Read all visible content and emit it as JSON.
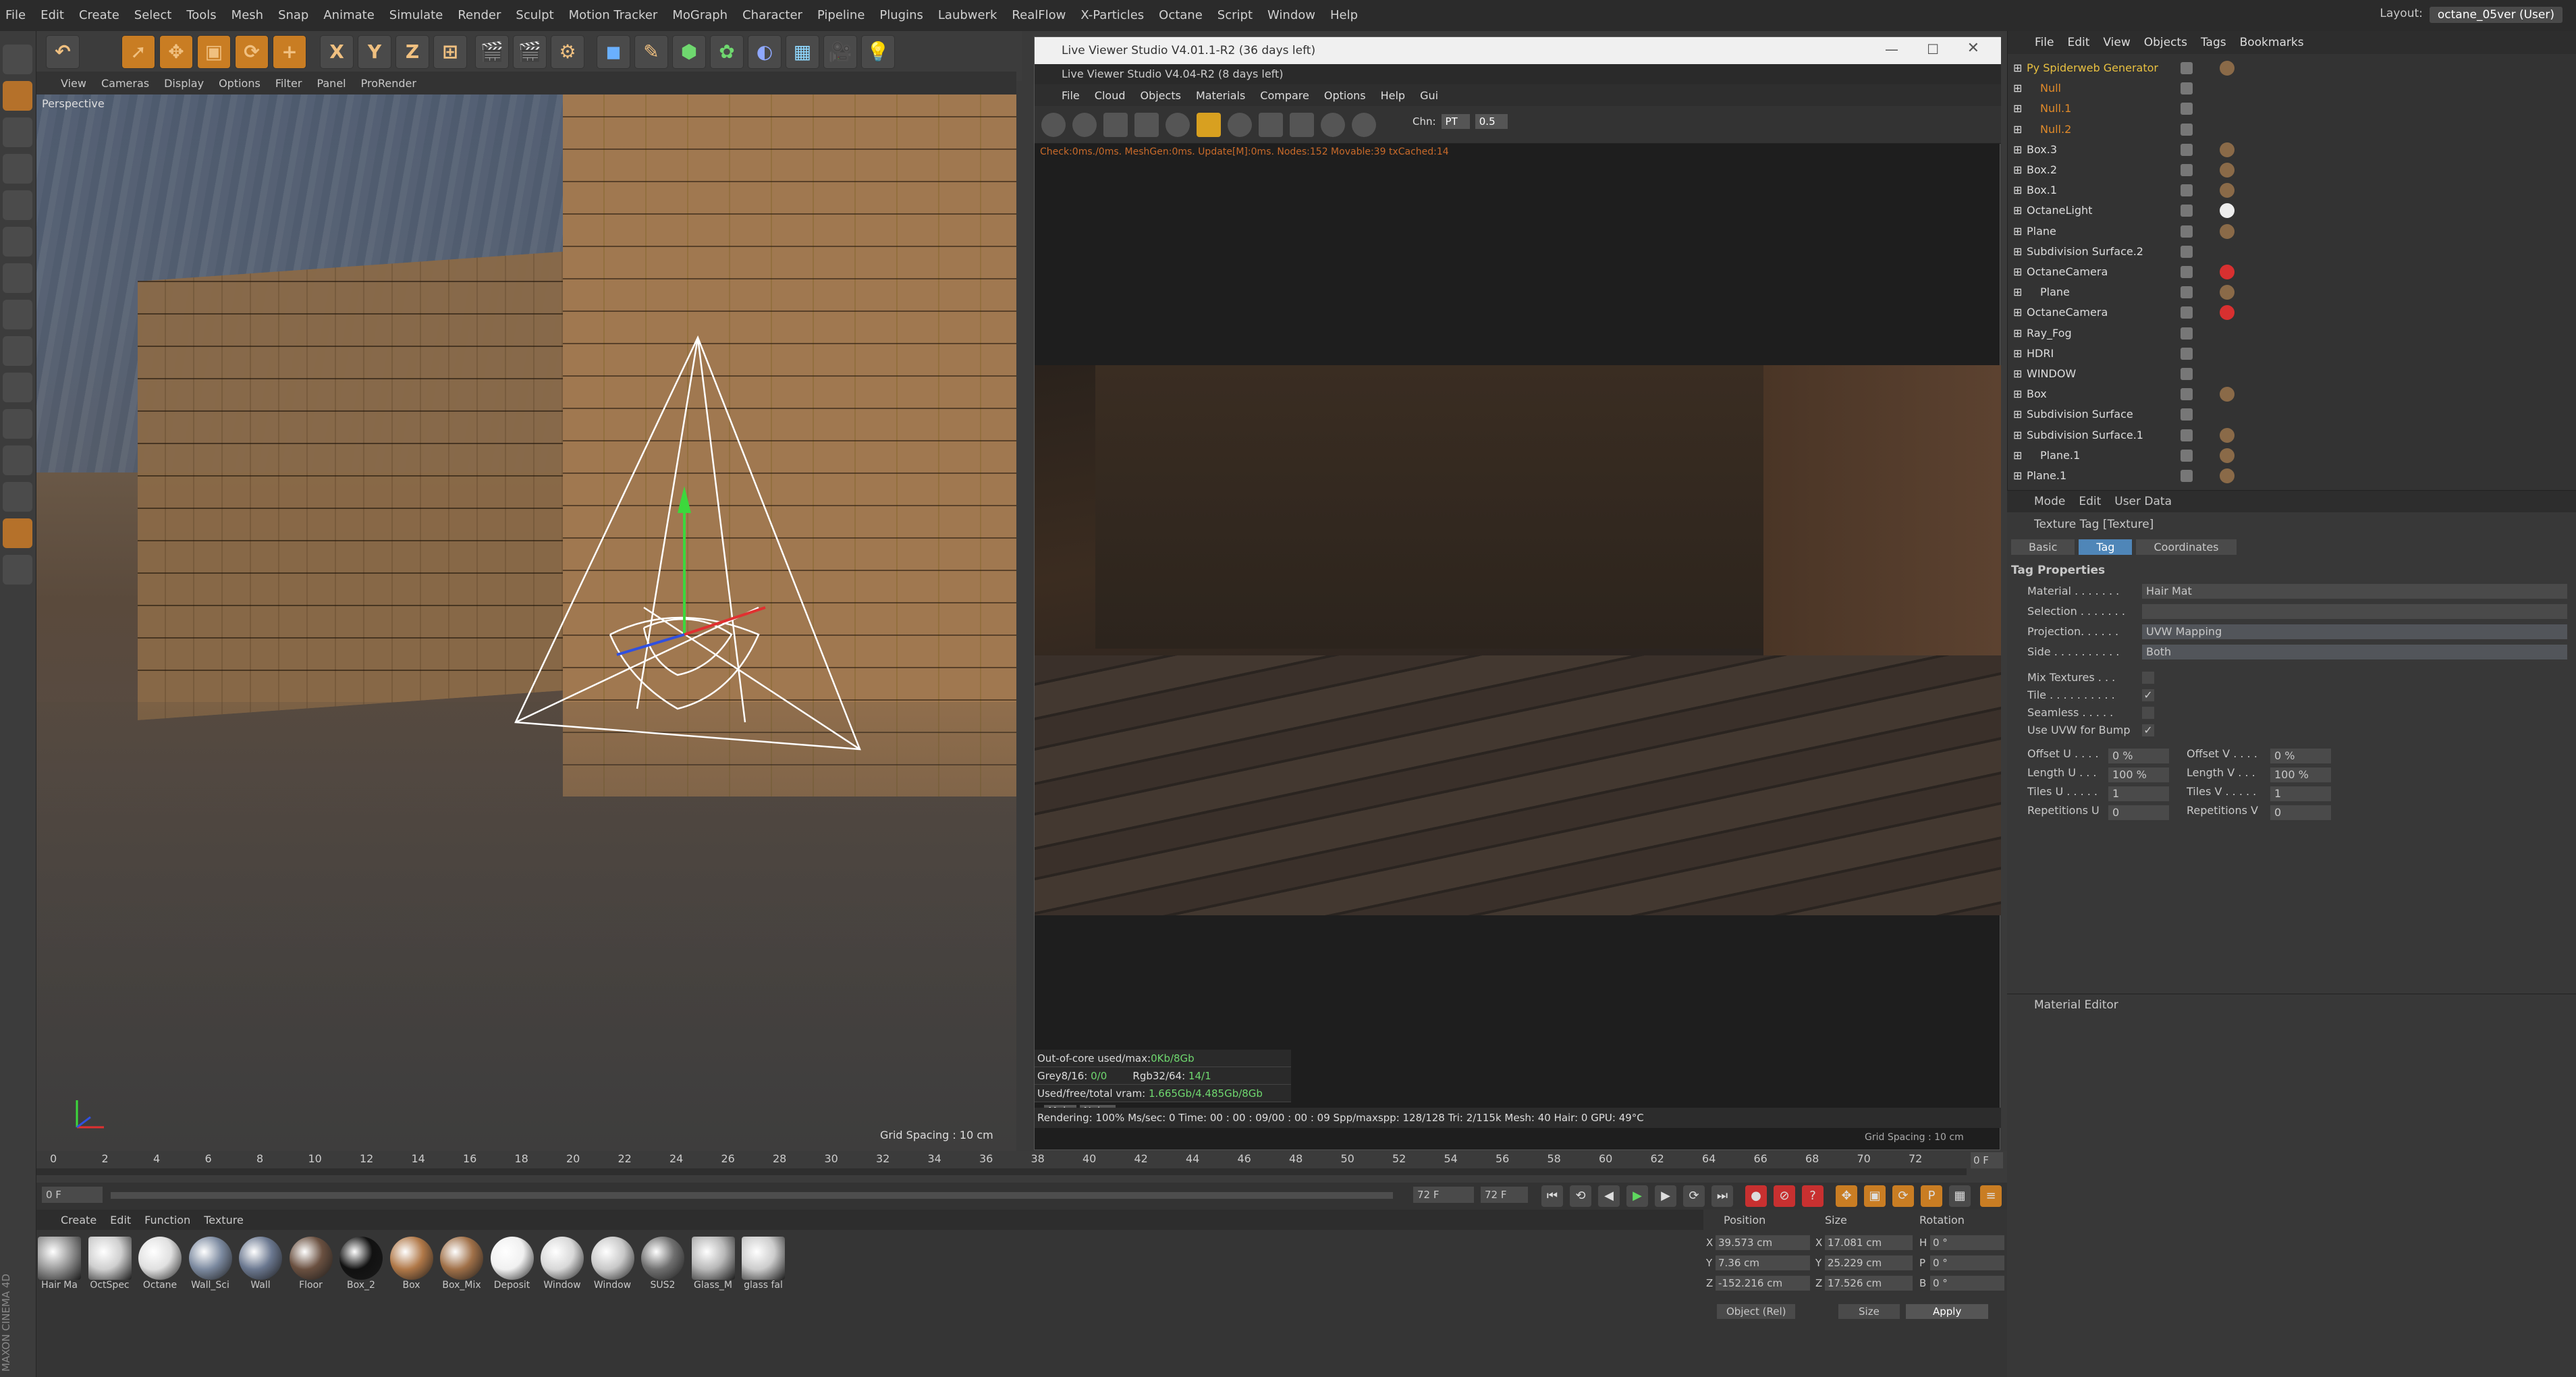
{
  "app": {
    "menu": [
      "File",
      "Edit",
      "Create",
      "Select",
      "Tools",
      "Mesh",
      "Snap",
      "Animate",
      "Simulate",
      "Render",
      "Sculpt",
      "Motion Tracker",
      "MoGraph",
      "Character",
      "Pipeline",
      "Plugins",
      "Laubwerk",
      "RealFlow",
      "X-Particles",
      "Octane",
      "Script",
      "Window",
      "Help"
    ],
    "layout_label": "Layout:",
    "layout_value": "octane_05ver (User)",
    "brand": "MAXON CINEMA 4D"
  },
  "toolbar": {
    "axis_x": "X",
    "axis_y": "Y",
    "axis_z": "Z"
  },
  "viewport": {
    "menu": [
      "View",
      "Cameras",
      "Display",
      "Options",
      "Filter",
      "Panel",
      "ProRender"
    ],
    "label": "Perspective",
    "grid_spacing": "Grid Spacing : 10 cm"
  },
  "live_viewer": {
    "title": "Live Viewer Studio V4.01.1-R2 (36 days left)",
    "subtitle": "Live Viewer Studio V4.04-R2 (8 days left)",
    "menu": [
      "File",
      "Cloud",
      "Objects",
      "Materials",
      "Compare",
      "Options",
      "Help",
      "Gui"
    ],
    "chn_label": "Chn:",
    "chn_value": "PT",
    "chn_num": "0.5",
    "status_line": "Check:0ms./0ms. MeshGen:0ms. Update[M]:0ms. Nodes:152 Movable:39 txCached:14",
    "info": {
      "out_of_core_label": "Out-of-core used/max:",
      "out_of_core_value": "0Kb/8Gb",
      "grey_label": "Grey8/16:",
      "grey_value": "0/0",
      "rgb_label": "Rgb32/64:",
      "rgb_value": "14/1",
      "vram_label": "Used/free/total vram:",
      "vram_value": "1.665Gb/4.485Gb/8Gb",
      "btn_main": "Main",
      "btn_noise": "Noise"
    },
    "render_status": "Rendering: 100%  Ms/sec: 0   Time: 00 : 00 : 09/00 : 00 : 09   Spp/maxspp: 128/128   Tri: 2/115k  Mesh: 40   Hair: 0   GPU: 49°C",
    "grid_spacing": "Grid Spacing : 10 cm"
  },
  "object_manager": {
    "menu": [
      "File",
      "Edit",
      "View",
      "Objects",
      "Tags",
      "Bookmarks"
    ],
    "rows": [
      {
        "name": "Py Spiderweb Generator",
        "style": "sel"
      },
      {
        "name": "Null",
        "style": "orange"
      },
      {
        "name": "Null.1",
        "style": "orange"
      },
      {
        "name": "Null.2",
        "style": "orange"
      },
      {
        "name": "Box.3",
        "style": ""
      },
      {
        "name": "Box.2",
        "style": ""
      },
      {
        "name": "Box.1",
        "style": ""
      },
      {
        "name": "OctaneLight",
        "style": ""
      },
      {
        "name": "Plane",
        "style": ""
      },
      {
        "name": "Subdivision Surface.2",
        "style": ""
      },
      {
        "name": "OctaneCamera",
        "style": ""
      },
      {
        "name": "Plane",
        "style": ""
      },
      {
        "name": "OctaneCamera",
        "style": ""
      },
      {
        "name": "Ray_Fog",
        "style": ""
      },
      {
        "name": "HDRI",
        "style": ""
      },
      {
        "name": "WINDOW",
        "style": ""
      },
      {
        "name": "Box",
        "style": ""
      },
      {
        "name": "Subdivision Surface",
        "style": ""
      },
      {
        "name": "Subdivision Surface.1",
        "style": ""
      },
      {
        "name": "Plane.1",
        "style": ""
      },
      {
        "name": "Plane.1",
        "style": ""
      }
    ]
  },
  "attributes": {
    "menu": [
      "Mode",
      "Edit",
      "User Data"
    ],
    "title": "Texture Tag [Texture]",
    "tabs": [
      "Basic",
      "Tag",
      "Coordinates"
    ],
    "section": "Tag Properties",
    "material_label": "Material . . . . . . .",
    "material_value": "Hair Mat",
    "selection_label": "Selection . . . . . . .",
    "projection_label": "Projection. . . . . .",
    "projection_value": "UVW Mapping",
    "side_label": "Side . . . . . . . . . .",
    "side_value": "Both",
    "mix_label": "Mix Textures . . .",
    "tile_label": "Tile . . . . . . . . . .",
    "seamless_label": "Seamless . . . . .",
    "uvwbump_label": "Use UVW for Bump",
    "offset_u_label": "Offset U . . . .",
    "offset_u_value": "0 %",
    "offset_v_label": "Offset V . . . .",
    "offset_v_value": "0 %",
    "length_u_label": "Length U . . .",
    "length_u_value": "100 %",
    "length_v_label": "Length V . . .",
    "length_v_value": "100 %",
    "tiles_u_label": "Tiles U . . . . .",
    "tiles_u_value": "1",
    "tiles_v_label": "Tiles V . . . . .",
    "tiles_v_value": "1",
    "rep_u_label": "Repetitions U",
    "rep_u_value": "0",
    "rep_v_label": "Repetitions V",
    "rep_v_value": "0"
  },
  "material_editor": {
    "title": "Material Editor"
  },
  "timeline": {
    "ticks": [
      "0",
      "2",
      "4",
      "6",
      "8",
      "10",
      "12",
      "14",
      "16",
      "18",
      "20",
      "22",
      "24",
      "26",
      "28",
      "30",
      "32",
      "34",
      "36",
      "38",
      "40",
      "42",
      "44",
      "46",
      "48",
      "50",
      "52",
      "54",
      "56",
      "58",
      "60",
      "62",
      "64",
      "66",
      "68",
      "70",
      "72"
    ],
    "start_frame": "0 F",
    "end_frame": "72 F",
    "end_frame2": "72 F",
    "current_frame": "0 F"
  },
  "materials": {
    "menu": [
      "Create",
      "Edit",
      "Function",
      "Texture"
    ],
    "items": [
      {
        "label": "Hair Ma",
        "color": "#9a9a9a"
      },
      {
        "label": "OctSpec",
        "color": "#cfcfcf"
      },
      {
        "label": "Octane",
        "color": "#e0e0e0"
      },
      {
        "label": "Wall_Sci",
        "color": "#7c8aa0"
      },
      {
        "label": "Wall",
        "color": "#6b7890"
      },
      {
        "label": "Floor",
        "color": "#6a5040"
      },
      {
        "label": "Box_2",
        "color": "#111111"
      },
      {
        "label": "Box",
        "color": "#b07848"
      },
      {
        "label": "Box_Mix",
        "color": "#a07048"
      },
      {
        "label": "Deposit",
        "color": "#f0f0f0"
      },
      {
        "label": "Window",
        "color": "#d8d8d8"
      },
      {
        "label": "Window",
        "color": "#c8c8c8"
      },
      {
        "label": "SUS2",
        "color": "#707070"
      },
      {
        "label": "Glass_M",
        "color": "#b8b8b8"
      },
      {
        "label": "glass fal",
        "color": "#cccccc"
      }
    ]
  },
  "coordinates": {
    "hdr_position": "Position",
    "hdr_size": "Size",
    "hdr_rotation": "Rotation",
    "x_pos": "39.573 cm",
    "x_size": "17.081 cm",
    "h_rot": "0 °",
    "y_pos": "7.36 cm",
    "y_size": "25.229 cm",
    "p_rot": "0 °",
    "z_pos": "-152.216 cm",
    "z_size": "17.526 cm",
    "b_rot": "0 °",
    "lbl_x": "X",
    "lbl_y": "Y",
    "lbl_z": "Z",
    "lbl_h": "H",
    "lbl_p": "P",
    "lbl_b": "B",
    "mode_object": "Object (Rel)",
    "mode_size": "Size",
    "apply": "Apply"
  }
}
